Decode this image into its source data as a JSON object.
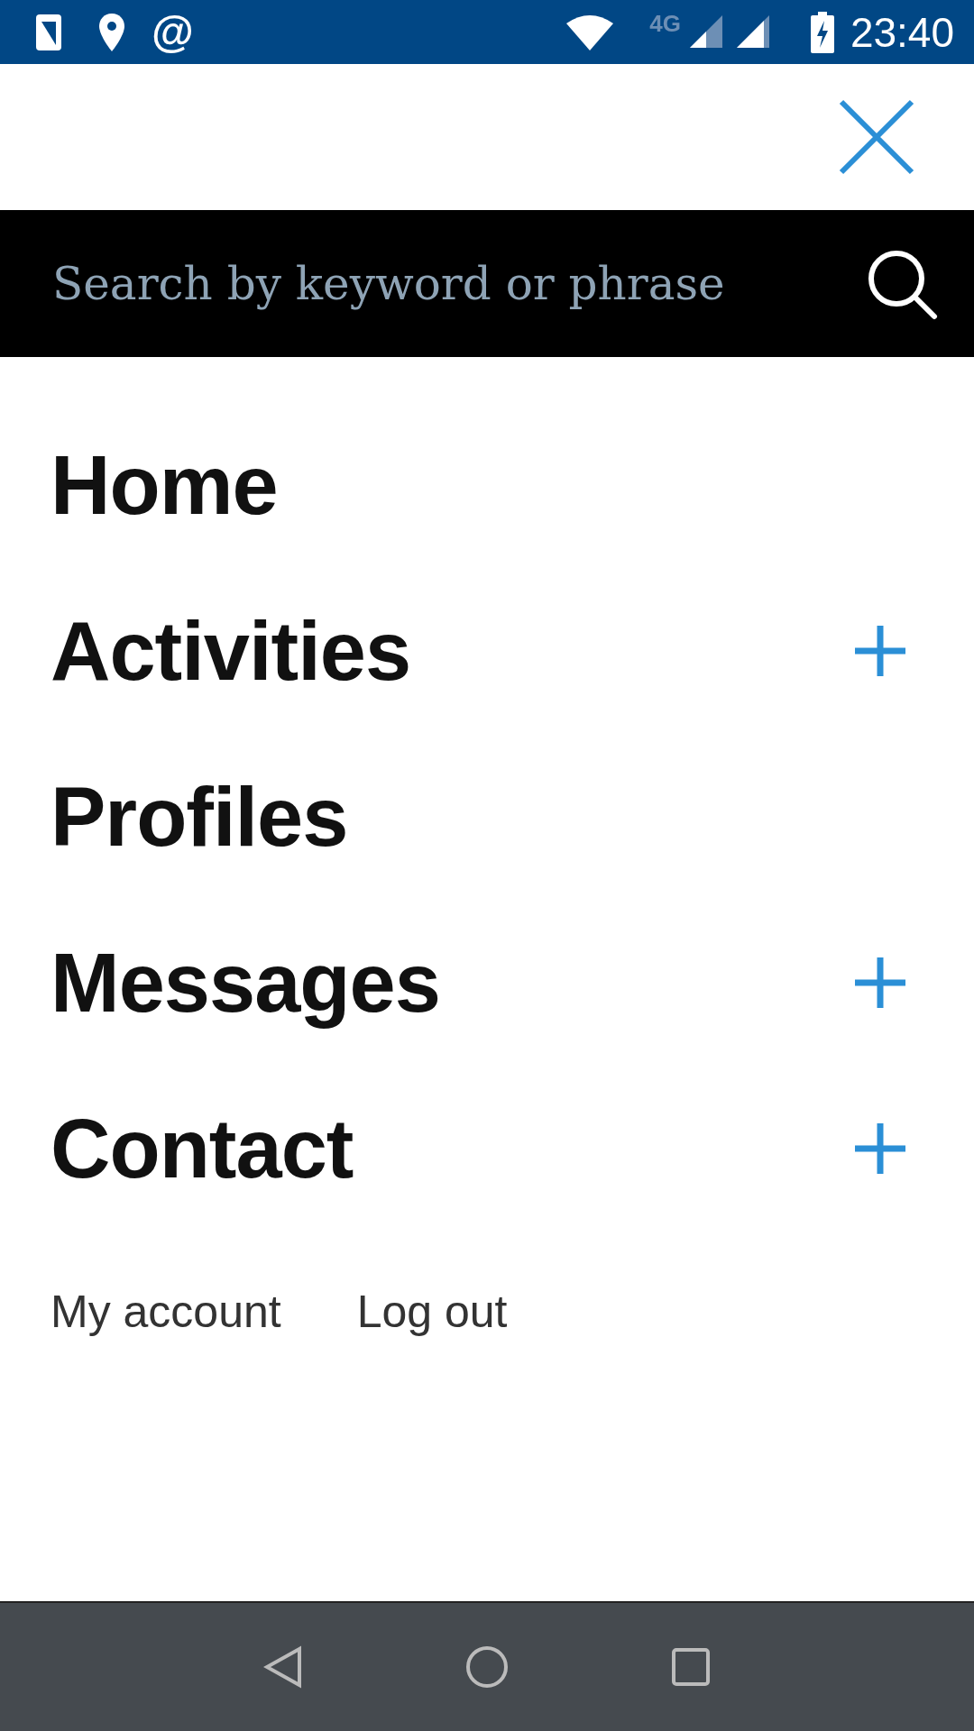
{
  "status_bar": {
    "notification_symbol": "@",
    "network_type": "4G",
    "time": "23:40"
  },
  "search": {
    "placeholder": "Search by keyword or phrase"
  },
  "menu": [
    {
      "label": "Home",
      "expandable": false
    },
    {
      "label": "Activities",
      "expandable": true
    },
    {
      "label": "Profiles",
      "expandable": false
    },
    {
      "label": "Messages",
      "expandable": true
    },
    {
      "label": "Contact",
      "expandable": true
    }
  ],
  "footer_links": [
    "My account",
    "Log out"
  ]
}
